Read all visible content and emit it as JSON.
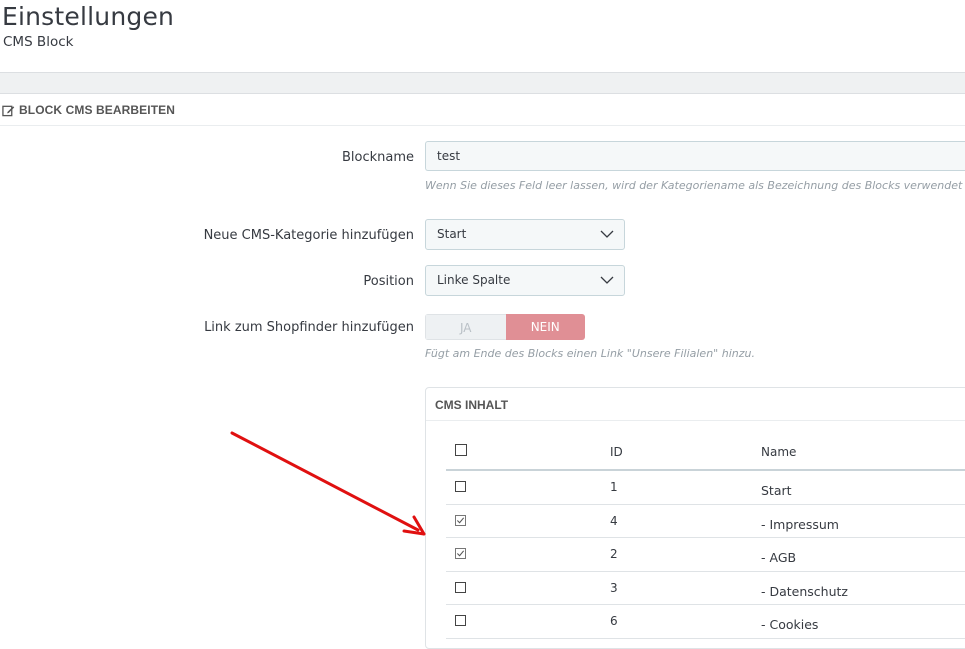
{
  "header": {
    "title": "Einstellungen",
    "subtitle": "CMS Block"
  },
  "panel": {
    "heading": "Block CMS bearbeiten"
  },
  "form": {
    "blockname_label": "Blockname",
    "blockname_value": "test",
    "blockname_help": "Wenn Sie dieses Feld leer lassen, wird der Kategoriename als Bezeichnung des Blocks verwendet",
    "category_label": "Neue CMS-Kategorie hinzufügen",
    "category_value": "Start",
    "position_label": "Position",
    "position_value": "Linke Spalte",
    "shopfinder_label": "Link zum Shopfinder hinzufügen",
    "switch_yes": "JA",
    "switch_no": "NEIN",
    "switch_selected": "NEIN",
    "shopfinder_help": "Fügt am Ende des Blocks einen Link \"Unsere Filialen\" hinzu."
  },
  "cms": {
    "title": "CMS Inhalt",
    "columns": {
      "id": "ID",
      "name": "Name"
    },
    "rows": [
      {
        "id": "1",
        "name": "Start",
        "checked": false
      },
      {
        "id": "4",
        "name": "- Impressum",
        "checked": true
      },
      {
        "id": "2",
        "name": "- AGB",
        "checked": true
      },
      {
        "id": "3",
        "name": "- Datenschutz",
        "checked": false
      },
      {
        "id": "6",
        "name": "- Cookies",
        "checked": false
      }
    ]
  },
  "colors": {
    "annotation_arrow": "#e01010",
    "switch_no_bg": "#e08f95"
  }
}
